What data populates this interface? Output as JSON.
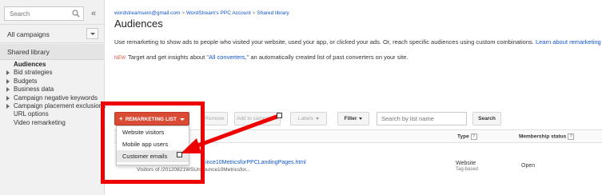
{
  "sidebar": {
    "search_placeholder": "Search",
    "collapse_label": "«",
    "all_campaigns": "All campaigns",
    "shared_library": "Shared library",
    "items": [
      {
        "label": "Audiences",
        "active": true,
        "expandable": false
      },
      {
        "label": "Bid strategies",
        "expandable": true
      },
      {
        "label": "Budgets",
        "expandable": true
      },
      {
        "label": "Business data",
        "expandable": true
      },
      {
        "label": "Campaign negative keywords",
        "expandable": true
      },
      {
        "label": "Campaign placement exclusions",
        "expandable": true
      },
      {
        "label": "URL options",
        "expandable": false
      },
      {
        "label": "Video remarketing",
        "expandable": false
      }
    ]
  },
  "breadcrumb": {
    "email": "wordstreamsem@gmail.com",
    "account": "WordStream's PPC Account",
    "section": "Shared library",
    "separator": ">"
  },
  "page_title": "Audiences",
  "intro": {
    "text": "Use remarketing to show ads to people who visited your website, used your app, or clicked your ads. Or, reach specific audiences using custom combinations.",
    "link": "Learn about remarketing"
  },
  "new_notice": {
    "badge": "NEW",
    "before": "Target and get insights about ",
    "link": "\"All converters,\"",
    "after": " an automatically created list of past converters on your site."
  },
  "toolbar": {
    "remarketing_list": "REMARKETING LIST",
    "plus": "+",
    "remove": "Remove",
    "add_to": "Add to campaigns",
    "labels": "Labels",
    "filter": "Filter",
    "search_placeholder": "Search by list name",
    "search_button": "Search"
  },
  "dropdown_menu": {
    "items": [
      "Website visitors",
      "Mobile app users",
      "Customer emails"
    ],
    "hovered_index": 2
  },
  "table": {
    "columns": {
      "type": "Type",
      "membership_status": "Membership status"
    },
    "help_glyph": "?",
    "rows": [
      {
        "name": "ince10MetricsforPPCLandingPages.html",
        "subtext": "Visitors of /20120821WSUnbounce10Metricsfor...",
        "type": "Website",
        "type_sub": "Tag-based",
        "membership_status": "Open"
      }
    ]
  },
  "annotation": {
    "color": "#ee0000"
  },
  "colors": {
    "accent_red": "#d94b35",
    "link_blue": "#1155cc",
    "sidebar_bg": "#f1f1f1"
  }
}
